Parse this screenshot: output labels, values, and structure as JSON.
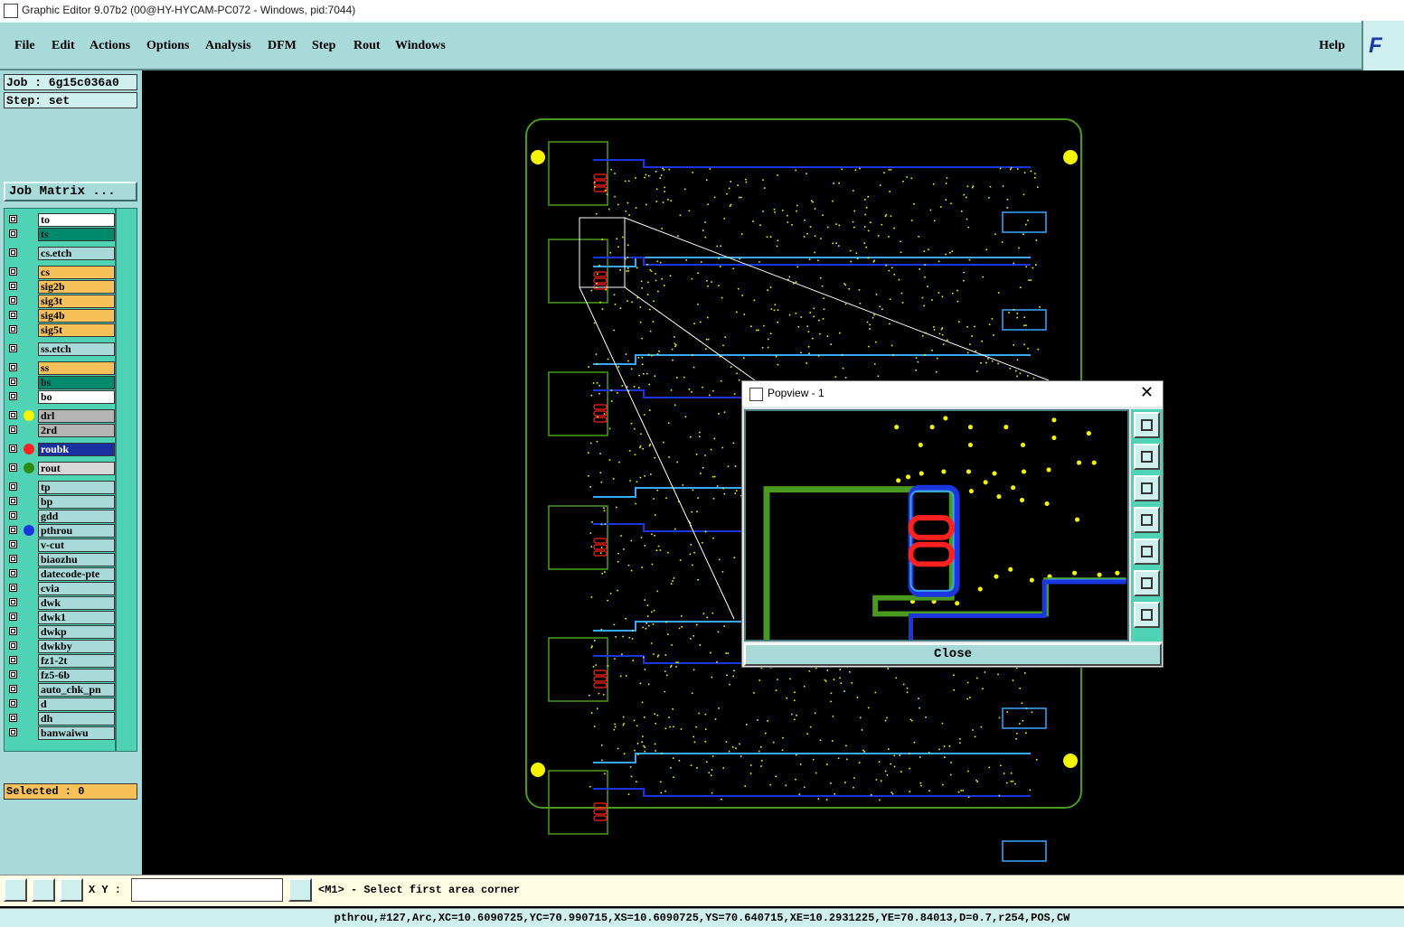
{
  "window": {
    "title": "Graphic Editor 9.07b2 (00@HY-HYCAM-PC072 - Windows, pid:7044)"
  },
  "menu": {
    "items": [
      "File",
      "Edit",
      "Actions",
      "Options",
      "Analysis",
      "DFM",
      "Step",
      "Rout",
      "Windows"
    ],
    "help": "Help",
    "logo": "F"
  },
  "job": {
    "job_line": "Job : 6g15c036a0",
    "step_line": "Step: set",
    "matrix_button": "Job Matrix ..."
  },
  "layers": [
    {
      "name": "to",
      "color": "#ffffff",
      "dot": ""
    },
    {
      "name": "ts",
      "color": "#00896b",
      "dot": ""
    },
    {
      "name": "cs.etch",
      "color": "#a9dada",
      "dot": ""
    },
    {
      "name": "cs",
      "color": "#f7c15a",
      "dot": ""
    },
    {
      "name": "sig2b",
      "color": "#f7c15a",
      "dot": ""
    },
    {
      "name": "sig3t",
      "color": "#f7c15a",
      "dot": ""
    },
    {
      "name": "sig4b",
      "color": "#f7c15a",
      "dot": ""
    },
    {
      "name": "sig5t",
      "color": "#f7c15a",
      "dot": ""
    },
    {
      "name": "ss.etch",
      "color": "#a9dada",
      "dot": ""
    },
    {
      "name": "ss",
      "color": "#f7c15a",
      "dot": ""
    },
    {
      "name": "bs",
      "color": "#00896b",
      "dot": ""
    },
    {
      "name": "bo",
      "color": "#ffffff",
      "dot": ""
    },
    {
      "name": "drl",
      "color": "#b4b4b4",
      "dot": "#f4f400"
    },
    {
      "name": "2rd",
      "color": "#b4b4b4",
      "dot": ""
    },
    {
      "name": "roubk",
      "color": "#1a2fa0",
      "dot": "#ff2020"
    },
    {
      "name": "rout",
      "color": "#d8d8d8",
      "dot": "#2e8b12"
    },
    {
      "name": "tp",
      "color": "#a9dada",
      "dot": ""
    },
    {
      "name": "bp",
      "color": "#a9dada",
      "dot": ""
    },
    {
      "name": "gdd",
      "color": "#a9dada",
      "dot": ""
    },
    {
      "name": "pthrou",
      "color": "#a9dada",
      "dot": "#1b35e0"
    },
    {
      "name": "v-cut",
      "color": "#a9dada",
      "dot": ""
    },
    {
      "name": "biaozhu",
      "color": "#a9dada",
      "dot": ""
    },
    {
      "name": "datecode-pte",
      "color": "#a9dada",
      "dot": ""
    },
    {
      "name": "cvia",
      "color": "#a9dada",
      "dot": ""
    },
    {
      "name": "dwk",
      "color": "#a9dada",
      "dot": ""
    },
    {
      "name": "dwk1",
      "color": "#a9dada",
      "dot": ""
    },
    {
      "name": "dwkp",
      "color": "#a9dada",
      "dot": ""
    },
    {
      "name": "dwkby",
      "color": "#a9dada",
      "dot": ""
    },
    {
      "name": "fz1-2t",
      "color": "#a9dada",
      "dot": ""
    },
    {
      "name": "fz5-6b",
      "color": "#a9dada",
      "dot": ""
    },
    {
      "name": "auto_chk_pn",
      "color": "#a9dada",
      "dot": ""
    },
    {
      "name": "d",
      "color": "#a9dada",
      "dot": ""
    },
    {
      "name": "dh",
      "color": "#a9dada",
      "dot": ""
    },
    {
      "name": "banwaiwu",
      "color": "#a9dada",
      "dot": ""
    }
  ],
  "selected": "Selected : 0",
  "xy": {
    "label": "X Y :",
    "value": ""
  },
  "prompt": "<M1> - Select first area corner",
  "status": "pthrou,#127,Arc,XC=10.6090725,YC=70.990715,XS=10.6090725,YS=70.640715,XE=10.2931225,YE=70.84013,D=0.7,r254,POS,CW",
  "popview": {
    "title": "Popview - 1",
    "close_label": "Close"
  }
}
